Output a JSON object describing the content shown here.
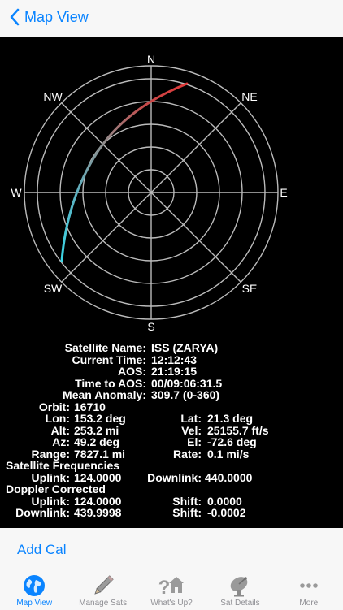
{
  "nav": {
    "back_label": "Map View"
  },
  "radar": {
    "directions": {
      "n": "N",
      "ne": "NE",
      "e": "E",
      "se": "SE",
      "s": "S",
      "sw": "SW",
      "w": "W",
      "nw": "NW"
    }
  },
  "info": {
    "satellite_name": {
      "label": "Satellite Name:",
      "value": "ISS (ZARYA)"
    },
    "current_time": {
      "label": "Current Time:",
      "value": "12:12:43"
    },
    "aos": {
      "label": "AOS:",
      "value": "21:19:15"
    },
    "time_to_aos": {
      "label": "Time to AOS:",
      "value": "00/09:06:31.5"
    },
    "mean_anomaly": {
      "label": "Mean Anomaly:",
      "value": "309.7 (0-360)"
    },
    "orbit": {
      "label": "Orbit:",
      "value": "16710"
    },
    "lon": {
      "label": "Lon:",
      "value": "153.2 deg"
    },
    "lat": {
      "label": "Lat:",
      "value": "21.3 deg"
    },
    "alt": {
      "label": "Alt:",
      "value": "253.2 mi"
    },
    "vel": {
      "label": "Vel:",
      "value": "25155.7 ft/s"
    },
    "az": {
      "label": "Az:",
      "value": "49.2 deg"
    },
    "el": {
      "label": "El:",
      "value": "-72.6 deg"
    },
    "range": {
      "label": "Range:",
      "value": "7827.1 mi"
    },
    "rate": {
      "label": "Rate:",
      "value": "0.1 mi/s"
    },
    "frequencies_heading": "Satellite Frequencies",
    "uplink": {
      "label": "Uplink:",
      "value": "124.0000"
    },
    "downlink": {
      "label": "Downlink:",
      "value": "440.0000"
    },
    "doppler_heading": "Doppler Corrected",
    "doppler_uplink": {
      "label": "Uplink:",
      "value": "124.0000"
    },
    "shift_uplink": {
      "label": "Shift:",
      "value": "0.0000"
    },
    "doppler_downlink": {
      "label": "Downlink:",
      "value": "439.9998"
    },
    "shift_downlink": {
      "label": "Shift:",
      "value": "-0.0002"
    }
  },
  "bottom": {
    "add_cal_label": "Add Cal"
  },
  "tabs": [
    {
      "label": "Map View",
      "icon": "globe-icon",
      "active": true
    },
    {
      "label": "Manage Sats",
      "icon": "pencil-icon",
      "active": false
    },
    {
      "label": "What's Up?",
      "icon": "question-house-icon",
      "active": false
    },
    {
      "label": "Sat Details",
      "icon": "satellite-dish-icon",
      "active": false
    },
    {
      "label": "More",
      "icon": "more-dots-icon",
      "active": false
    }
  ],
  "colors": {
    "accent": "#0a84ff",
    "track_start": "#e23a3a",
    "track_end": "#3ad6e6",
    "grid": "#bbbbbb",
    "background": "#000000"
  }
}
